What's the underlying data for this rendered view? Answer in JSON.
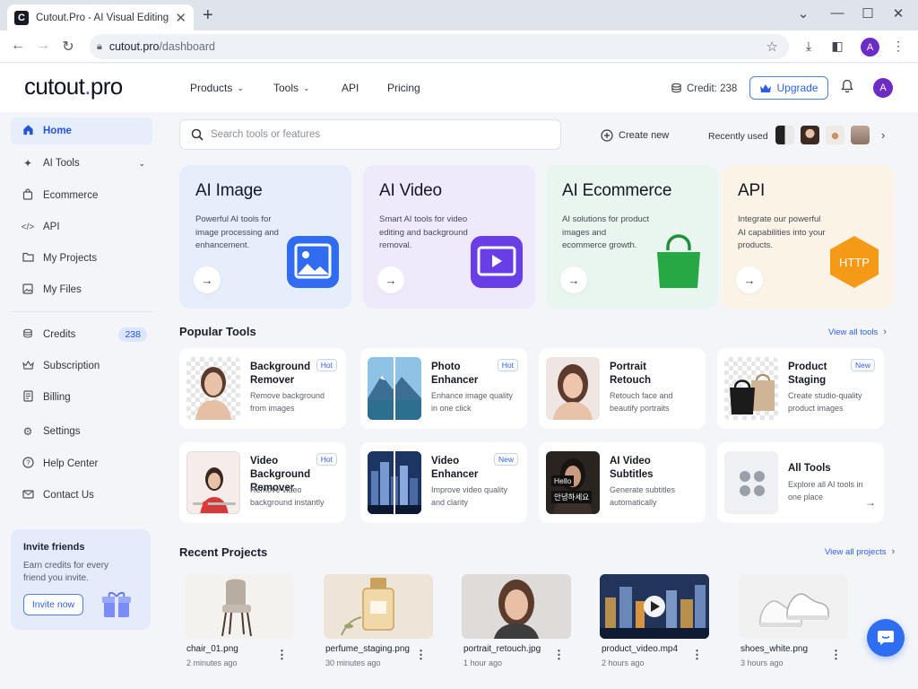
{
  "browser": {
    "tab_title": "Cutout.Pro - AI Visual Editing Pla",
    "favicon_letter": "C",
    "url_host": "cutout.pro",
    "url_path": "/dashboard",
    "profile_letter": "A"
  },
  "header": {
    "logo_main": "cutout",
    "logo_dot": ".",
    "logo_end": "pro",
    "nav": [
      "Products",
      "Tools",
      "API",
      "Pricing"
    ],
    "credit_label": "Credit: 238",
    "upgrade_label": "Upgrade",
    "avatar_letter": "A"
  },
  "sidebar": {
    "items": [
      {
        "label": "Home",
        "icon": "home-icon"
      },
      {
        "label": "AI Tools",
        "icon": "sparkle-icon"
      },
      {
        "label": "Ecommerce",
        "icon": "bag-icon"
      },
      {
        "label": "API",
        "icon": "code-icon"
      },
      {
        "label": "My Projects",
        "icon": "folder-icon"
      },
      {
        "label": "My Files",
        "icon": "image-icon"
      },
      {
        "label": "Credits",
        "icon": "coins-icon",
        "badge": "238"
      },
      {
        "label": "Subscription",
        "icon": "crown-icon"
      },
      {
        "label": "Billing",
        "icon": "receipt-icon"
      },
      {
        "label": "Settings",
        "icon": "gear-icon"
      },
      {
        "label": "Help Center",
        "icon": "help-icon"
      },
      {
        "label": "Contact Us",
        "icon": "mail-icon"
      }
    ],
    "invite": {
      "title": "Invite friends",
      "text": "Earn credits for every friend you invite.",
      "button": "Invite now"
    }
  },
  "search": {
    "placeholder": "Search tools or features"
  },
  "create_new": "Create new",
  "recently_used": "Recently used",
  "categories": [
    {
      "title": "AI Image",
      "desc": "Powerful AI tools for image processing and enhancement."
    },
    {
      "title": "AI Video",
      "desc": "Smart AI tools for video editing and background removal."
    },
    {
      "title": "AI Ecommerce",
      "desc": "AI solutions for product images and ecommerce growth."
    },
    {
      "title": "API",
      "desc": "Integrate our powerful AI capabilities into your products.",
      "badge": "HTTP"
    }
  ],
  "popular": {
    "title": "Popular Tools",
    "view_all": "View all tools",
    "tools": [
      {
        "name": "Background Remover",
        "desc": "Remove background from images",
        "tag": "Hot"
      },
      {
        "name": "Photo Enhancer",
        "desc": "Enhance image quality in one click",
        "tag": "Hot"
      },
      {
        "name": "Portrait Retouch",
        "desc": "Retouch face and beautify portraits",
        "tag": ""
      },
      {
        "name": "Product Staging",
        "desc": "Create studio-quality product images",
        "tag": "New"
      },
      {
        "name": "Video Background Remover",
        "desc": "Remove video background instantly",
        "tag": "Hot"
      },
      {
        "name": "Video Enhancer",
        "desc": "Improve video quality and clarity",
        "tag": "New"
      },
      {
        "name": "AI Video Subtitles",
        "desc": "Generate subtitles automatically",
        "tag": "",
        "subtitle_top": "Hello",
        "subtitle_bottom": "안녕하세요"
      },
      {
        "name": "All Tools",
        "desc": "Explore all AI tools in one place",
        "tag": ""
      }
    ]
  },
  "recent": {
    "title": "Recent Projects",
    "view_all": "View all projects",
    "projects": [
      {
        "name": "chair_01.png",
        "time": "2 minutes ago"
      },
      {
        "name": "perfume_staging.png",
        "time": "30 minutes ago"
      },
      {
        "name": "portrait_retouch.jpg",
        "time": "1 hour ago"
      },
      {
        "name": "product_video.mp4",
        "time": "2 hours ago"
      },
      {
        "name": "shoes_white.png",
        "time": "3 hours ago"
      }
    ]
  }
}
